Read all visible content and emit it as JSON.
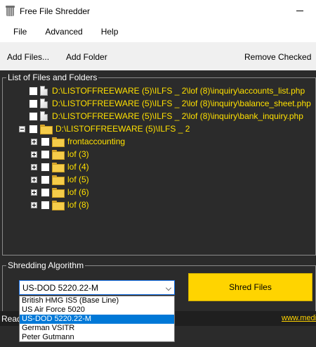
{
  "window": {
    "title": "Free File Shredder"
  },
  "menu": {
    "items": [
      {
        "label": "File"
      },
      {
        "label": "Advanced"
      },
      {
        "label": "Help"
      }
    ]
  },
  "toolbar": {
    "add_files": "Add Files...",
    "add_folder": "Add Folder",
    "remove_checked": "Remove Checked"
  },
  "files_group": {
    "label": "List of Files and Folders",
    "files": [
      {
        "label": "D:\\LISTOFFREEWARE (5)\\ILFS _ 2\\lof (8)\\inquiry\\accounts_list.php"
      },
      {
        "label": "D:\\LISTOFFREEWARE (5)\\ILFS _ 2\\lof (8)\\inquiry\\balance_sheet.php"
      },
      {
        "label": "D:\\LISTOFFREEWARE (5)\\ILFS _ 2\\lof (8)\\inquiry\\bank_inquiry.php"
      }
    ],
    "folder": {
      "label": "D:\\LISTOFFREEWARE (5)\\ILFS _ 2",
      "children": [
        {
          "label": "frontaccounting"
        },
        {
          "label": "lof (3)"
        },
        {
          "label": "lof (4)"
        },
        {
          "label": "lof (5)"
        },
        {
          "label": "lof (6)"
        },
        {
          "label": "lof (8)"
        }
      ]
    }
  },
  "algorithm_group": {
    "label": "Shredding Algorithm",
    "selected": "US-DOD 5220.22-M",
    "options": [
      {
        "label": "British HMG IS5 (Base Line)",
        "selected": false
      },
      {
        "label": "US Air Force 5020",
        "selected": false
      },
      {
        "label": "US-DOD 5220.22-M",
        "selected": true
      },
      {
        "label": "German VSITR",
        "selected": false
      },
      {
        "label": "Peter Gutmann",
        "selected": false
      }
    ]
  },
  "shred_button": {
    "label": "Shred Files"
  },
  "status": {
    "text": "Read",
    "link": "www.medi"
  },
  "colors": {
    "accent": "#ffd400",
    "tree_text": "#ffe000",
    "background": "#2b2b2b",
    "selection": "#0078d7"
  }
}
